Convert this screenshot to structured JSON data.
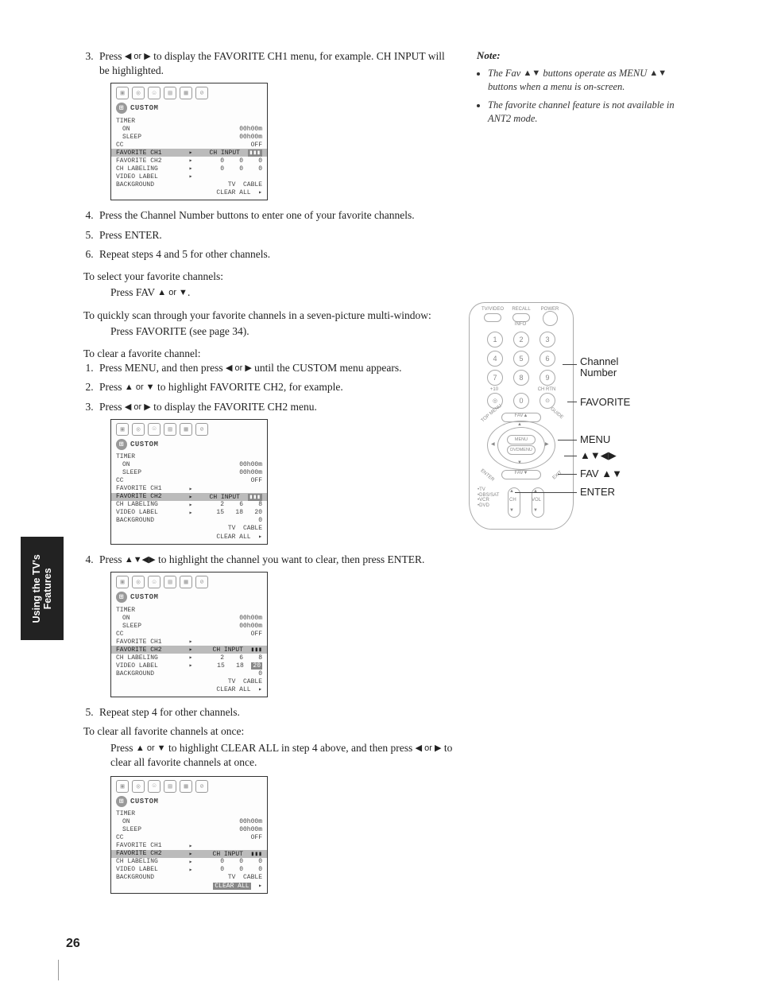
{
  "page_number": "26",
  "side_tab": {
    "line1": "Using the TV's",
    "line2": "Features"
  },
  "steps_top": [
    {
      "n": "3",
      "pre": "Press ",
      "sym": "◀ or ▶",
      "post": " to display the FAVORITE CH1 menu, for example. CH INPUT will be highlighted."
    }
  ],
  "steps_top2": [
    {
      "n": "4",
      "text": "Press the Channel Number buttons to enter one of your favorite channels."
    },
    {
      "n": "5",
      "text": "Press ENTER."
    },
    {
      "n": "6",
      "text": "Repeat steps 4 and 5 for other channels."
    }
  ],
  "select_head": "To select your favorite channels:",
  "select_line_pre": "Press FAV ",
  "select_line_sym": "▲ or ▼",
  "select_line_post": ".",
  "scan_head": "To quickly scan through your favorite channels in a seven-picture multi-window:",
  "scan_line": "Press FAVORITE (see page 34).",
  "clear_head": "To clear a favorite channel:",
  "clear_steps_a": [
    {
      "n": "1",
      "pre": "Press MENU, and then press ",
      "sym": "◀ or ▶",
      "post": " until the CUSTOM menu appears."
    },
    {
      "n": "2",
      "pre": "Press ",
      "sym": "▲ or ▼",
      "post": " to highlight FAVORITE CH2, for example."
    },
    {
      "n": "3",
      "pre": "Press ",
      "sym": "◀ or ▶",
      "post": " to display the FAVORITE CH2 menu."
    }
  ],
  "clear_steps_b": [
    {
      "n": "4",
      "pre": "Press ",
      "sym": "▲▼◀▶",
      "post": " to highlight the channel you want to clear, then press ENTER."
    }
  ],
  "clear_steps_c": [
    {
      "n": "5",
      "text": "Repeat step 4 for other channels."
    }
  ],
  "clear_all_head": "To clear all favorite channels at once:",
  "clear_all_line1_pre": "Press ",
  "clear_all_line1_sym": "▲ or ▼",
  "clear_all_line1_post": " to highlight CLEAR ALL in step 4 above, and then press ",
  "clear_all_line1_sym2": "◀ or ▶",
  "clear_all_line1_post2": " to clear all favorite channels at once.",
  "note_head": "Note:",
  "notes": [
    {
      "pre": "The Fav ",
      "sym": "▲▼",
      "mid": " buttons operate as MENU ",
      "sym2": "▲▼",
      "post": " buttons when a menu is on-screen."
    },
    {
      "text": "The favorite channel feature is not available in ANT2 mode."
    }
  ],
  "callouts": {
    "chnum": "Channel Number",
    "fav": "FAVORITE",
    "menu": "MENU",
    "arrows": "▲▼◀▶",
    "favab": "FAV ▲▼",
    "enter": "ENTER"
  },
  "osd": {
    "title": "CUSTOM",
    "timer": "TIMER",
    "on": "ON",
    "sleep": "SLEEP",
    "cc": "CC",
    "fav1": "FAVORITE CH1",
    "fav2": "FAVORITE CH2",
    "chlabel": "CH LABELING",
    "videolabel": "VIDEO LABEL",
    "background": "BACKGROUND",
    "v00": "00h00m",
    "voff": "OFF",
    "chinput": "CH INPUT",
    "zeros": "0    0    0",
    "clearall": "CLEAR ALL",
    "tvcable": "TV  CABLE",
    "nums_row1": "2    6    8",
    "nums_row2": "15   18   20",
    "nums_row3": "0"
  },
  "remote": {
    "top": {
      "tvvideo": "TV/VIDEO",
      "recall": "RECALL",
      "power": "POWER",
      "info": "INFO"
    },
    "plus10": "+10",
    "chrtn": "CH RTN",
    "fava": "FAV▲",
    "favb": "FAV▼",
    "menu": "MENU",
    "dvdmenu": "DVDMENU",
    "side": {
      "tv": "TV",
      "dbs": "DBS/SAT",
      "vcr": "VCR",
      "dvd": "DVD"
    },
    "ch": "CH",
    "vol": "VOL",
    "diag": {
      "tl": "TOP MENU",
      "tr": "GUIDE",
      "bl": "ENTER",
      "br": "EXIT"
    }
  }
}
